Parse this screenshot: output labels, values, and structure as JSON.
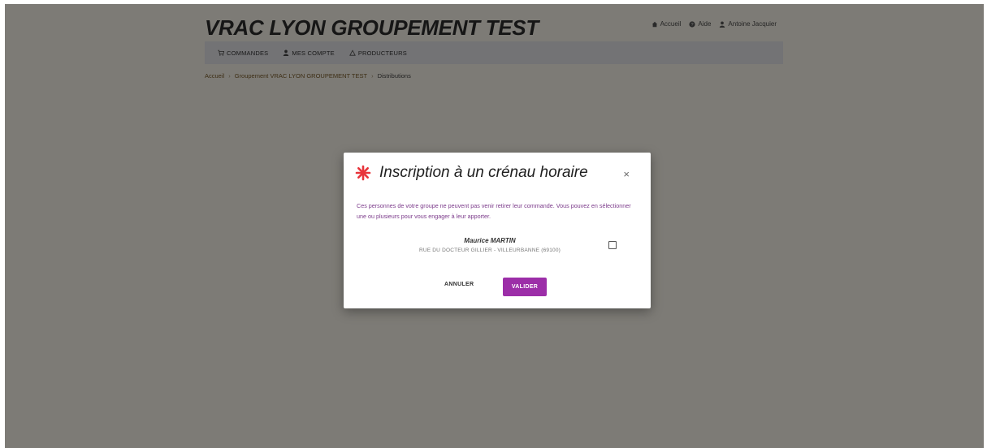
{
  "site": {
    "title": "VRAC LYON GROUPEMENT TEST"
  },
  "top_links": [
    {
      "label": "Accueil",
      "icon": "home-icon"
    },
    {
      "label": "Aide",
      "icon": "help-icon"
    },
    {
      "label": "Antoine Jacquier",
      "icon": "user-icon"
    }
  ],
  "nav": [
    {
      "label": "COMMANDES",
      "icon": "cart-icon"
    },
    {
      "label": "MES COMPTE",
      "icon": "user-icon"
    },
    {
      "label": "PRODUCTEURS",
      "icon": "producer-icon"
    }
  ],
  "breadcrumb": [
    "Accueil",
    "Groupement VRAC LYON GROUPEMENT TEST",
    "Distributions"
  ],
  "modal": {
    "title": "Inscription à un crénau horaire",
    "close_symbol": "×",
    "text": "Ces personnes de votre groupe ne peuvent pas venir retirer leur commande. Vous pouvez en sélectionner une ou plusieurs pour vous engager à leur apporter.",
    "person_name": "Maurice MARTIN",
    "person_address": "RUE DU DOCTEUR GILLIER - VILLEURBANNE (69100)",
    "cancel_label": "ANNULER",
    "validate_label": "VALIDER"
  },
  "colors": {
    "accent": "#9c2ea8",
    "title_icon": "#e8353b",
    "overlay": "rgba(0,0,0,0.5)"
  }
}
